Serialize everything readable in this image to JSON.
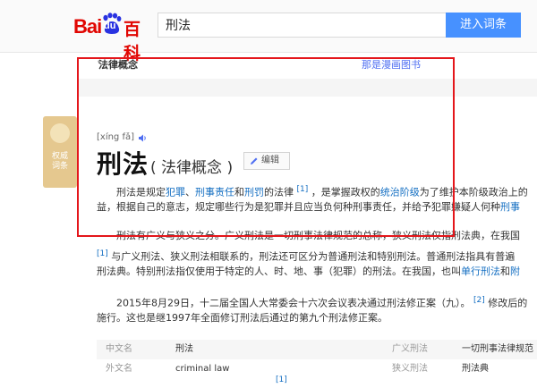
{
  "header": {
    "logo_bai": "Bai",
    "logo_du": "du",
    "logo_baike": "百科",
    "search_value": "刑法",
    "search_button": "进入词条"
  },
  "subnav": {
    "crumb": "法律概念",
    "right_link": "那是漫画图书"
  },
  "badge": {
    "line1": "权威",
    "line2": "词条"
  },
  "entry": {
    "pinyin": "[xíng fǎ]",
    "title": "刑法",
    "subtitle": "( 法律概念 )",
    "edit_label": "编辑"
  },
  "paragraphs": {
    "p1_l1_a": "刑法是规定",
    "p1_l1_link1": "犯罪",
    "p1_l1_sep1": "、",
    "p1_l1_link2": "刑事责任",
    "p1_l1_and": "和",
    "p1_l1_link3": "刑罚",
    "p1_l1_b": "的法律 ",
    "p1_l1_ref": "[1]",
    "p1_l1_c": " ，是掌握政权的",
    "p1_l1_link4": "统治阶级",
    "p1_l1_d": "为了维护本阶级政治上的",
    "p1_l2_a": "益，根据自己的意志，规定哪些行为是犯罪并且应当负何种刑事责任，并给予犯罪嫌疑人何种",
    "p1_l2_link": "刑事",
    "p2_l1": "刑法有广义与狭义之分。广义刑法是一切刑事法律规范的总称，狭义刑法仅指刑法典，在我国",
    "p2_l2_ref": "[1]",
    "p2_l2": " 与广义刑法、狭义刑法相联系的，刑法还可区分为普通刑法和特别刑法。普通刑法指具有普遍",
    "p2_l3_a": "刑法典。特别刑法指仅使用于特定的人、时、地、事（犯罪）的刑法。在我国，也叫",
    "p2_l3_link1": "单行刑法",
    "p2_l3_and": "和",
    "p2_l3_link2": "附",
    "p3_l1_a": "2015年8月29日，十二届全国人大常委会十六次会议表决通过刑法修正案（九）。 ",
    "p3_l1_ref": "[2]",
    "p3_l1_b": " 修改后的",
    "p3_l2": "施行。这也是继1997年全面修订刑法后通过的第九个刑法修正案。"
  },
  "info_table": [
    {
      "k1": "中文名",
      "v1": "刑法",
      "k2": "广义刑法",
      "v2": "一切刑事法律规范"
    },
    {
      "k1": "外文名",
      "v1": "criminal law",
      "k2": "狭义刑法",
      "v2": "刑法典"
    },
    {
      "k1": "",
      "v1": "",
      "k2": "",
      "v2": "",
      "ref": "[1]"
    }
  ],
  "colors": {
    "brand_red": "#e10602",
    "search_blue": "#4791ff",
    "link_blue": "#136ec2",
    "highlight_red": "#e4161b",
    "badge_gold": "#e5c88f"
  },
  "icons": [
    "baidu-paw-icon",
    "speaker-icon",
    "pencil-icon",
    "badge-emblem-icon"
  ]
}
